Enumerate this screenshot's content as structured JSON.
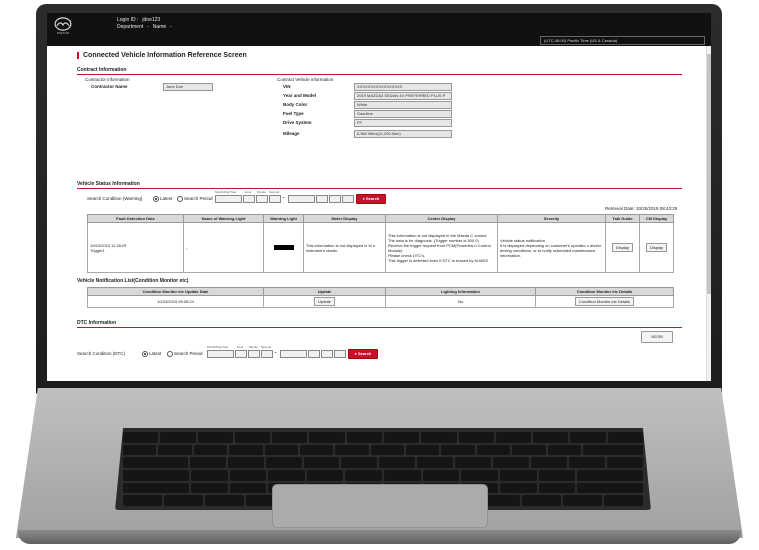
{
  "header": {
    "logo_text": "mazda",
    "login_label": "Login ID :",
    "login_value": "jdoe123",
    "department_label": "Department",
    "department_value": "-",
    "name_label": "Name",
    "name_value": "-",
    "timezone": "(UTC-08:00) Pacific Time (US & Canada)"
  },
  "page_title": "Connected Vehicle Information Reference Screen",
  "contract": {
    "section_title": "Contract Information",
    "contractor_info_label": "Contractor information",
    "contractor_name_label": "Contractor Name",
    "contractor_name_value": "Jane Doe",
    "vehicle_info_label": "Contract Vehicle information",
    "fields": [
      {
        "label": "VIN",
        "value": "XXXXXXXXXXXXXXXXX"
      },
      {
        "label": "Year and Model",
        "value": "2019 MAZDA3 SEDAN 4V PREFERRED PLUS P"
      },
      {
        "label": "Body Color",
        "value": "White"
      },
      {
        "label": "Fuel Type",
        "value": "Gasoline"
      },
      {
        "label": "Drive System",
        "value": "FF"
      },
      {
        "label": "Mileage",
        "value": "6,960 Miles(11,200.0km)"
      }
    ]
  },
  "vehicle_status": {
    "section_title": "Vehicle Status Information",
    "search_condition_label": "Search Condition (Warning)",
    "latest_label": "Latest",
    "search_period_label": "Search Period",
    "date_hint": "Month/Day/Year",
    "hour_hint": "Hour",
    "minute_hint": "Minute",
    "second_hint": "Second",
    "search_button": "Search",
    "retrieval_date": "Retrieval Date: 10/25/2019 08:43:25",
    "columns": [
      "Fault Detection Date",
      "Name of Warning Light",
      "Warning Light",
      "Meter Display",
      "Center Display",
      "Severity",
      "Talk Guide",
      "CM Display"
    ],
    "row": {
      "date": "10/24/2019 11:28:29",
      "trigger": "Trigger1",
      "name": "-",
      "meter": "This information is not displayed in th e instrument cluster",
      "center_lines": [
        "This information is not displayed in the Mazda C onnect.",
        "The data is for diagnosis. (Trigger number is 500 0)",
        "Receive the trigger request from PCM(Powertrai n Control Module)",
        "Please check DTC's.",
        "This trigger is detected even if DTC is erased by M-MDS"
      ],
      "severity_lines": [
        "Vehicle status notification",
        "It is displayed depending on customer's operatio n and/or driving conditions, or to notify scheduled maintenance information."
      ],
      "talk_guide_button": "Display",
      "cm_display_button": "Display"
    }
  },
  "notification": {
    "section_title": "Vehicle Notification List(Condition Monitor etc)",
    "columns": [
      "Condition Monitor etc Update Date",
      "Update",
      "Lighting Information",
      "Condition Monitor etc Details"
    ],
    "row": {
      "date": "10/23/2019 05:05:24",
      "update_button": "Update",
      "lighting": "No",
      "details_button": "Condition Monitor etc Details"
    }
  },
  "dtc": {
    "section_title": "DTC Information",
    "mdsb_button": "MDSB",
    "search_condition_label": "Search Condition (DTC)",
    "latest_label": "Latest",
    "search_period_label": "Search Period",
    "search_button": "Search"
  },
  "colors": {
    "accent": "#c8102e",
    "header_bg": "#111111"
  }
}
